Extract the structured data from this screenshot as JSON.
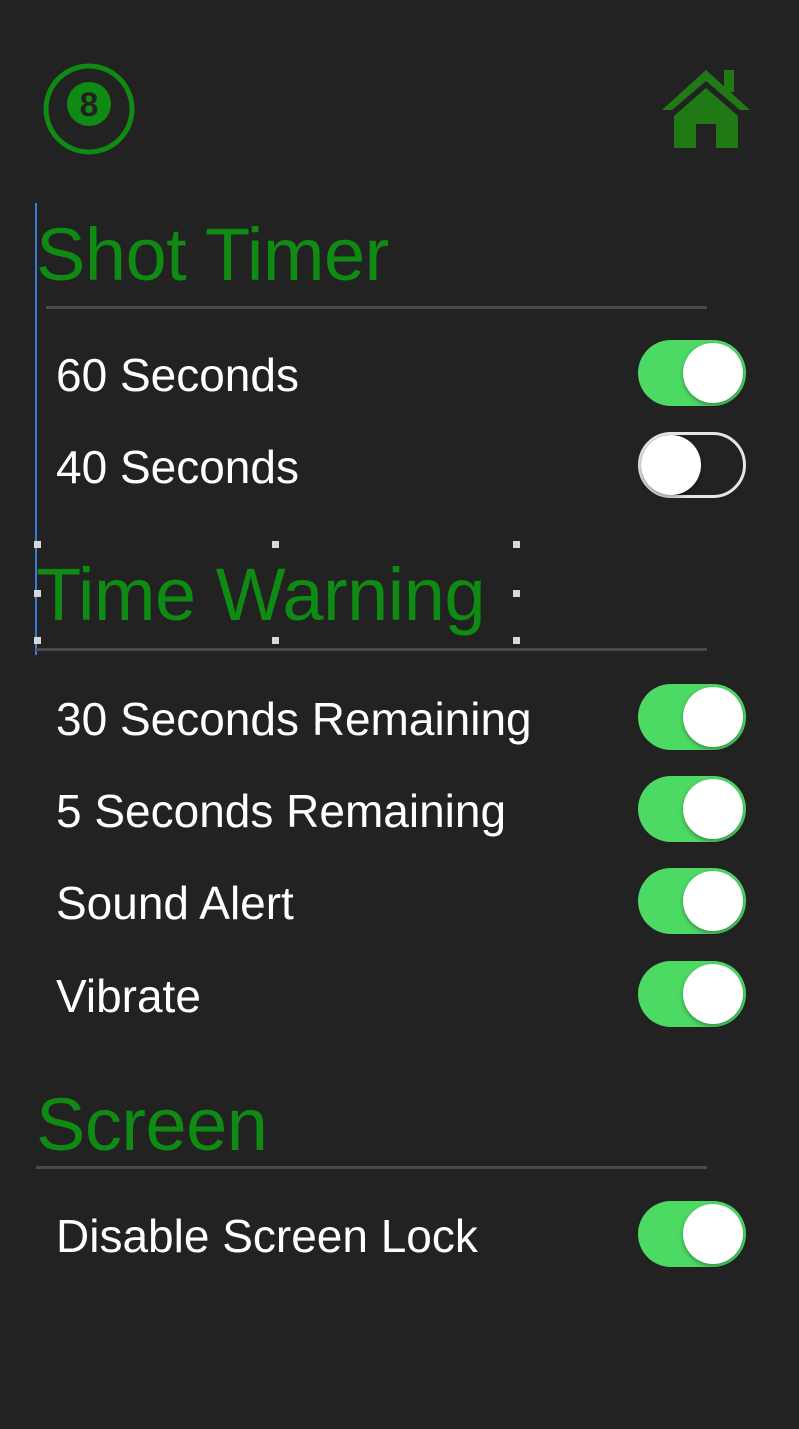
{
  "header": {
    "ball_icon": "eight-ball-icon",
    "ball_glyph": "8",
    "home_icon": "home-icon"
  },
  "colors": {
    "background": "#222222",
    "accent": "#0f8a12",
    "toggle_on": "#4cd964",
    "text": "#ffffff",
    "divider": "#4a4a4a"
  },
  "sections": {
    "shot_timer": {
      "title": "Shot Timer",
      "items": [
        {
          "label": "60 Seconds",
          "on": true
        },
        {
          "label": "40 Seconds",
          "on": false
        }
      ]
    },
    "time_warning": {
      "title": "Time Warning",
      "items": [
        {
          "label": "30 Seconds Remaining",
          "on": true
        },
        {
          "label": "5 Seconds Remaining",
          "on": true
        },
        {
          "label": "Sound Alert",
          "on": true
        },
        {
          "label": "Vibrate",
          "on": true
        }
      ]
    },
    "screen": {
      "title": "Screen",
      "items": [
        {
          "label": "Disable Screen Lock",
          "on": true
        }
      ]
    }
  }
}
